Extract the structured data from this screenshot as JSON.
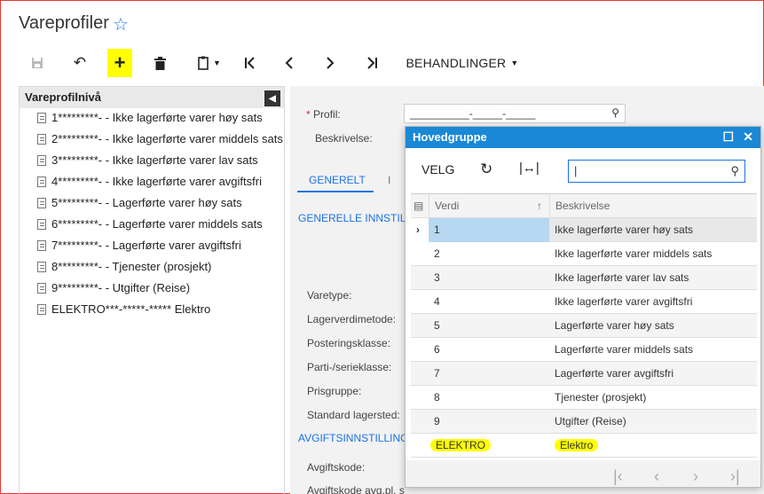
{
  "app": {
    "title": "Vareprofiler"
  },
  "toolbar": {
    "behandlinger": "BEHANDLINGER"
  },
  "tree": {
    "header": "Vareprofilnivå",
    "items": [
      "1*********- - Ikke lagerførte varer høy sats",
      "2*********- - Ikke lagerførte varer middels sats",
      "3*********- - Ikke lagerførte varer lav sats",
      "4*********- - Ikke lagerførte varer avgiftsfri",
      "5*********- - Lagerførte varer høy sats",
      "6*********- - Lagerførte varer middels sats",
      "7*********- - Lagerførte varer avgiftsfri",
      "8*********- - Tjenester (prosjekt)",
      "9*********- - Utgifter (Reise)",
      "ELEKTRO***-*****-***** Elektro"
    ]
  },
  "form": {
    "profil_label": "Profil:",
    "profil_value": "__________-_____-_____",
    "beskrivelse_label": "Beskrivelse:",
    "tab_generelt": "GENERELT",
    "tab_partial": "I",
    "section_generelle": "GENERELLE INNSTIL",
    "section_avgift": "AVGIFTSINNSTILLING",
    "fields": [
      "Varetype:",
      "Lagerverdimetode:",
      "Posteringsklasse:",
      "Parti-/serieklasse:",
      "Prisgruppe:",
      "Standard lagersted:",
      "Avgiftskode:",
      "Avgiftskode avg.pl. s"
    ]
  },
  "popup": {
    "title": "Hovedgruppe",
    "velg": "VELG",
    "search_value": "|",
    "col_verdi": "Verdi",
    "col_beskrivelse": "Beskrivelse",
    "rows": [
      {
        "verdi": "1",
        "beskrivelse": "Ikke lagerførte varer høy sats"
      },
      {
        "verdi": "2",
        "beskrivelse": "Ikke lagerførte varer middels sats"
      },
      {
        "verdi": "3",
        "beskrivelse": "Ikke lagerførte varer lav sats"
      },
      {
        "verdi": "4",
        "beskrivelse": "Ikke lagerførte varer avgiftsfri"
      },
      {
        "verdi": "5",
        "beskrivelse": "Lagerførte varer høy sats"
      },
      {
        "verdi": "6",
        "beskrivelse": "Lagerførte varer middels sats"
      },
      {
        "verdi": "7",
        "beskrivelse": "Lagerførte varer avgiftsfri"
      },
      {
        "verdi": "8",
        "beskrivelse": "Tjenester (prosjekt)"
      },
      {
        "verdi": "9",
        "beskrivelse": "Utgifter (Reise)"
      },
      {
        "verdi": "ELEKTRO",
        "beskrivelse": "Elektro"
      }
    ]
  }
}
